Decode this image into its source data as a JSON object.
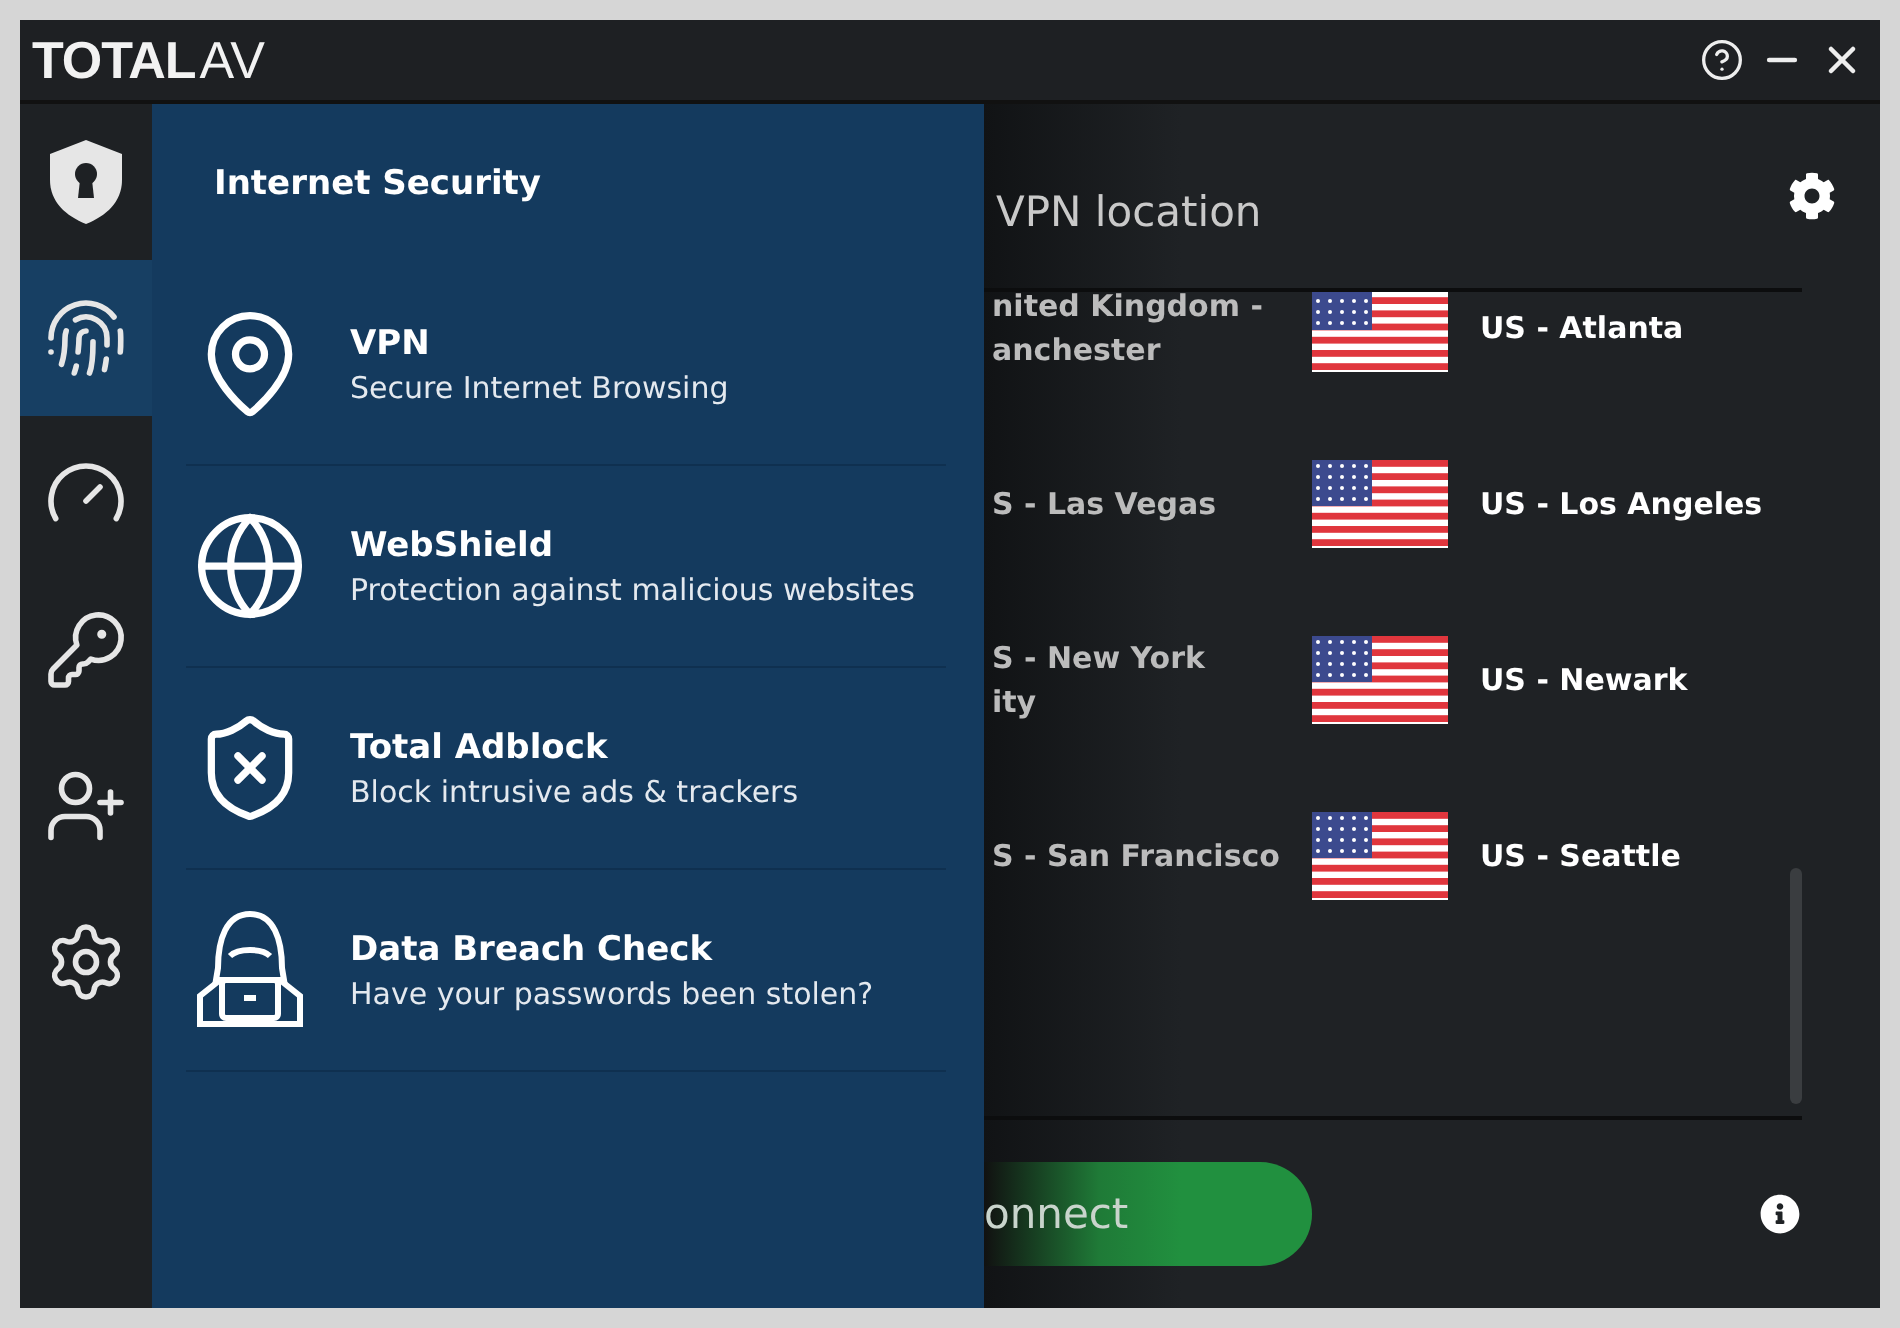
{
  "logo": {
    "bold": "TOTAL",
    "light": "AV"
  },
  "rail": [
    {
      "kind": "shield",
      "selected": false
    },
    {
      "kind": "fingerprint",
      "selected": true
    },
    {
      "kind": "gauge",
      "selected": false
    },
    {
      "kind": "key",
      "selected": false
    },
    {
      "kind": "user-add",
      "selected": false
    },
    {
      "kind": "gear",
      "selected": false
    }
  ],
  "menu": {
    "title": "Internet Security",
    "items": [
      {
        "kind": "pin",
        "title": "VPN",
        "subtitle": "Secure Internet Browsing"
      },
      {
        "kind": "globe",
        "title": "WebShield",
        "subtitle": "Protection against malicious websites"
      },
      {
        "kind": "shield-x",
        "title": "Total Adblock",
        "subtitle": "Block intrusive ads & trackers"
      },
      {
        "kind": "hacker",
        "title": "Data Breach Check",
        "subtitle": "Have your passwords been stolen?"
      }
    ]
  },
  "vpn": {
    "heading": "VPN location",
    "rows": [
      {
        "left": [
          "nited Kingdom -",
          "anchester"
        ],
        "right": "US - Atlanta"
      },
      {
        "left": [
          "S - Las Vegas"
        ],
        "right": "US - Los Angeles"
      },
      {
        "left": [
          "S - New York",
          "ity"
        ],
        "right": "US - Newark"
      },
      {
        "left": [
          "S - San Francisco"
        ],
        "right": "US - Seattle"
      }
    ],
    "connect": "onnect"
  }
}
